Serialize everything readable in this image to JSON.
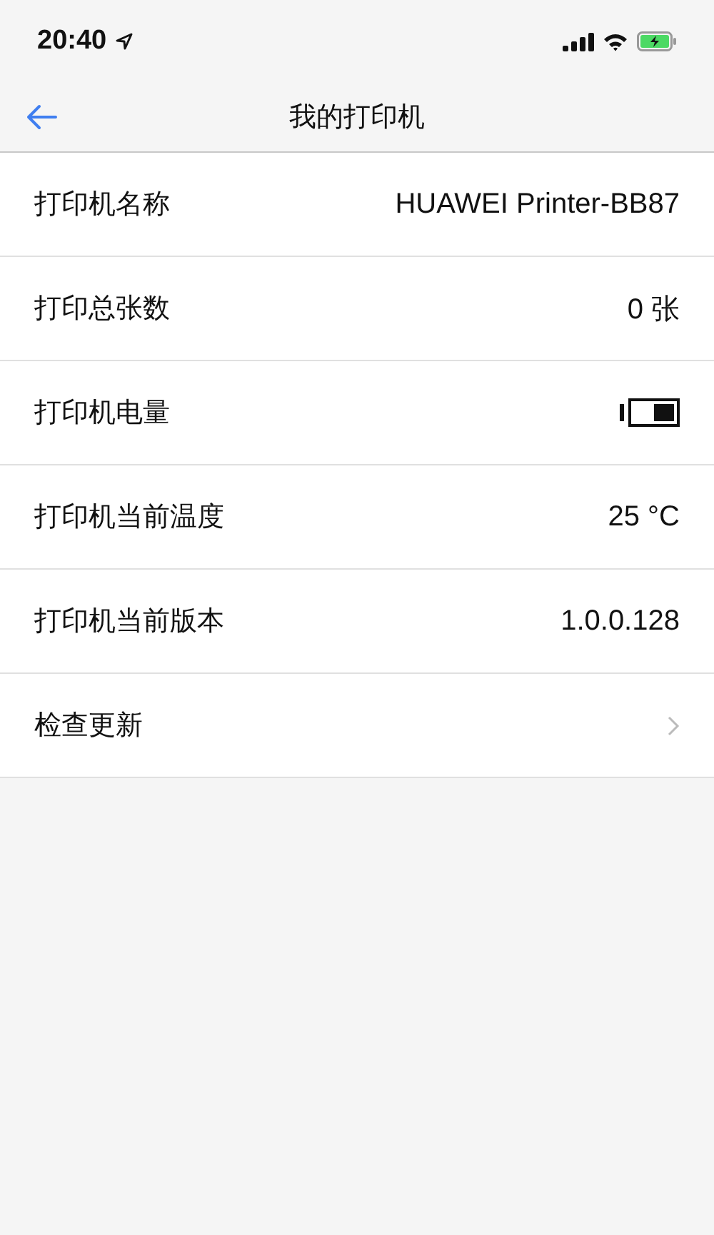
{
  "status_bar": {
    "time": "20:40"
  },
  "nav": {
    "title": "我的打印机"
  },
  "rows": [
    {
      "kind": "text",
      "label": "打印机名称",
      "value": "HUAWEI Printer-BB87"
    },
    {
      "kind": "text",
      "label": "打印总张数",
      "value": "0 张"
    },
    {
      "kind": "battery",
      "label": "打印机电量"
    },
    {
      "kind": "text",
      "label": "打印机当前温度",
      "value": "25 °C"
    },
    {
      "kind": "text",
      "label": "打印机当前版本",
      "value": "1.0.0.128"
    },
    {
      "kind": "link",
      "label": "检查更新"
    }
  ]
}
